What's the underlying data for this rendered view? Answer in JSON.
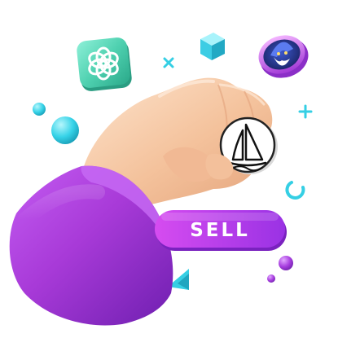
{
  "sell_button": {
    "label": "SELL"
  },
  "icons": [
    "chatgpt-logo-icon",
    "wizard-coin-icon",
    "midjourney-sailboat-coin-icon"
  ],
  "colors": {
    "sleeve_purple": "#a93bd8",
    "sell_gradient_start": "#d64cf0",
    "sell_gradient_end": "#8f2fe0",
    "chatgpt_tile_green": "#4fd1b0",
    "accent_cyan": "#33d2e6",
    "skin": "#f6c9a6"
  }
}
